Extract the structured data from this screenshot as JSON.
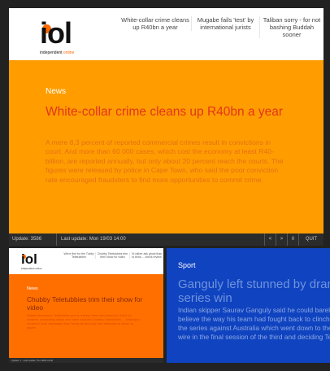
{
  "main": {
    "logo_text": "iol",
    "logo_sub_a": "independent",
    "logo_sub_b": "online",
    "headlines": [
      "White-collar crime cleans up R40bn a year",
      "Mugabe fails 'test' by international jurists",
      "Taliban sorry - for not bashing Buddah sooner"
    ],
    "section": "News",
    "headline": "White-collar crime cleans up R40bn a year",
    "summary": "A mere 8,3 percent of reported commercial crimes result in convictions in court. And more than 60 000 cases, which cost the economy at least R40-billion, are reported annually, but only about 20 percent reach the courts. The figures were released by police in Cape Town, who said the poor conviction rate encouraged fraudsters to find more opportunities to commit crime.",
    "status": {
      "update": "Update: 3586",
      "last_update": "Last update: Mon 19/03 14:00",
      "prev": "<",
      "next": ">",
      "pause": "II",
      "quit": "QUIT"
    }
  },
  "small": {
    "logo_text": "iol",
    "logo_sub": "independent online",
    "headlines": [
      "We're fine for the Tubby Teletubbies",
      "Chubby Teletubbies trim their show for video",
      "I'd rather ask ghost than to think ... check review"
    ],
    "section": "News",
    "headline": "Chubby Teletubbies trim their show for video",
    "summary": "British television's Teletubbies are to release their own beach-fit video for children, presenting critics who have said the Chubby Teletubbies ... 'helping to reinforce' poor messages that 'being fat and jolly' are attributes to which to aspire.",
    "status": "Update: 1 · Last update: Thu 19/03 14:00"
  },
  "sport": {
    "section": "Sport",
    "headline": "Ganguly left stunned by dramatic series win",
    "summary": "Indian skipper Saurav Ganguly said he could barely believe the way his team had fought back to clinch the series against Australia which went down to the wire in the final session of the third and deciding Test."
  },
  "colors": {
    "main_bg": "#ff9d00",
    "headline_red": "#e3341b",
    "small_bg": "#ff6f00",
    "sport_bg": "#1043c0",
    "statusbar": "#2b2b2b"
  }
}
